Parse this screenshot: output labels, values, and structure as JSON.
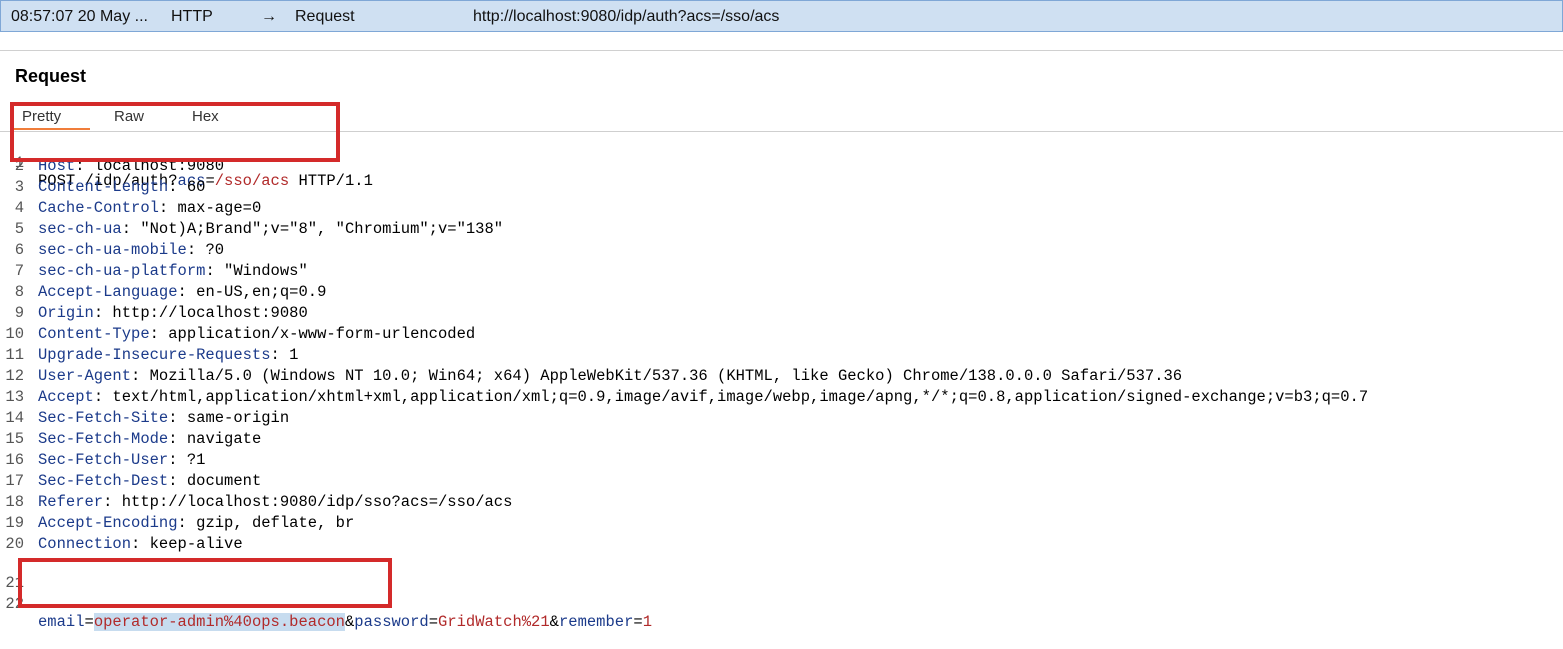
{
  "topbar": {
    "time": "08:57:07 20 May ...",
    "protocol": "HTTP",
    "direction_arrow": "→",
    "type": "Request",
    "url": "http://localhost:9080/idp/auth?acs=/sso/acs"
  },
  "panel": {
    "heading": "Request",
    "tabs": [
      "Pretty",
      "Raw",
      "Hex"
    ],
    "active_tab": "Pretty"
  },
  "request": {
    "request_line": {
      "method_path": "POST /idp/auth?",
      "param_key": "acs",
      "equals": "=",
      "param_value": "/sso/acs",
      "version": " HTTP/1.1"
    },
    "headers": [
      {
        "name": "Host",
        "value": " localhost:9080"
      },
      {
        "name": "Content-Length",
        "value": " 60"
      },
      {
        "name": "Cache-Control",
        "value": " max-age=0"
      },
      {
        "name": "sec-ch-ua",
        "value": " \"Not)A;Brand\";v=\"8\", \"Chromium\";v=\"138\""
      },
      {
        "name": "sec-ch-ua-mobile",
        "value": " ?0"
      },
      {
        "name": "sec-ch-ua-platform",
        "value": " \"Windows\""
      },
      {
        "name": "Accept-Language",
        "value": " en-US,en;q=0.9"
      },
      {
        "name": "Origin",
        "value": " http://localhost:9080"
      },
      {
        "name": "Content-Type",
        "value": " application/x-www-form-urlencoded"
      },
      {
        "name": "Upgrade-Insecure-Requests",
        "value": " 1"
      },
      {
        "name": "User-Agent",
        "value": " Mozilla/5.0 (Windows NT 10.0; Win64; x64) AppleWebKit/537.36 (KHTML, like Gecko) Chrome/138.0.0.0 Safari/537.36"
      },
      {
        "name": "Accept",
        "value": " text/html,application/xhtml+xml,application/xml;q=0.9,image/avif,image/webp,image/apng,*/*;q=0.8,application/signed-exchange;v=b3;q=0.7"
      },
      {
        "name": "Sec-Fetch-Site",
        "value": " same-origin"
      },
      {
        "name": "Sec-Fetch-Mode",
        "value": " navigate"
      },
      {
        "name": "Sec-Fetch-User",
        "value": " ?1"
      },
      {
        "name": "Sec-Fetch-Dest",
        "value": " document"
      },
      {
        "name": "Referer",
        "value": " http://localhost:9080/idp/sso?acs=/sso/acs"
      },
      {
        "name": "Accept-Encoding",
        "value": " gzip, deflate, br"
      },
      {
        "name": "Connection",
        "value": " keep-alive"
      }
    ],
    "body": {
      "k1": "email",
      "eq1": "=",
      "v1": "operator-admin%40ops.beacon",
      "amp1": "&",
      "k2": "password",
      "eq2": "=",
      "v2": "GridWatch%21",
      "amp2": "&",
      "k3": "remember",
      "eq3": "=",
      "v3": "1"
    },
    "line_numbers": [
      "1",
      "2",
      "3",
      "4",
      "5",
      "6",
      "7",
      "8",
      "9",
      "10",
      "11",
      "12",
      "13",
      "14",
      "15",
      "16",
      "17",
      "18",
      "19",
      "20",
      "21",
      "22"
    ]
  },
  "colors": {
    "highlight_box": "#d42a2a",
    "header_key": "#1b3a8a",
    "param_value": "#b12a2a",
    "active_tab_underline": "#f07d3a",
    "topbar_bg": "#cfe0f2"
  }
}
